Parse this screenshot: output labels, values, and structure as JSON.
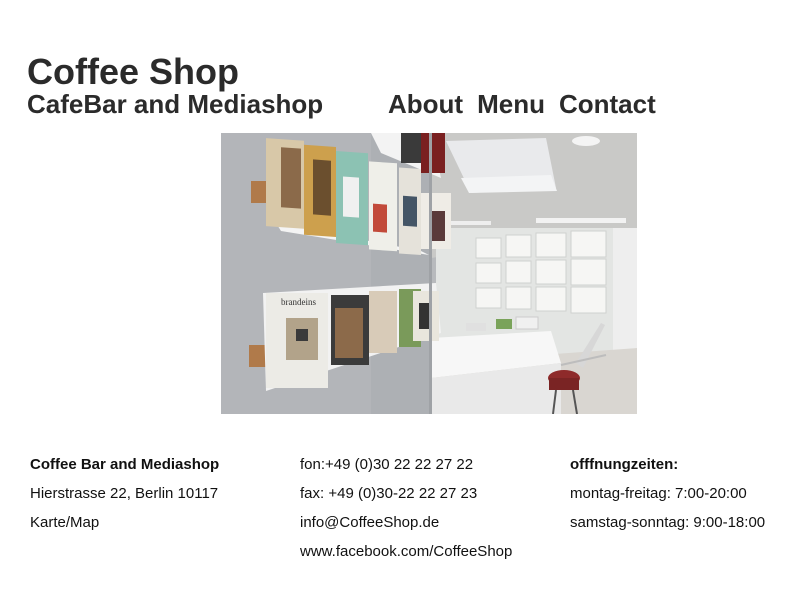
{
  "header": {
    "title": "Coffee Shop",
    "tagline": "CafeBar and Mediashop"
  },
  "nav": {
    "items": [
      {
        "label": "About"
      },
      {
        "label": "Menu"
      },
      {
        "label": "Contact"
      }
    ]
  },
  "hero": {
    "image": "coffee-shop-interior-photo",
    "magazine_text": "brandeins"
  },
  "footer": {
    "address": {
      "name": "Coffee Bar and Mediashop",
      "street": "Hierstrasse 22, Berlin 10117",
      "map_link": "Karte/Map"
    },
    "contact": {
      "phone": "fon:+49 (0)30 22 22 27 22",
      "fax": "fax: +49 (0)30-22 22 27 23",
      "email": "info@CoffeeShop.de",
      "facebook": "www.facebook.com/CoffeeShop"
    },
    "hours": {
      "heading": "offfnungzeiten:",
      "weekdays": "montag-freitag: 7:00-20:00",
      "weekend": "samstag-sonntag: 9:00-18:00"
    }
  }
}
